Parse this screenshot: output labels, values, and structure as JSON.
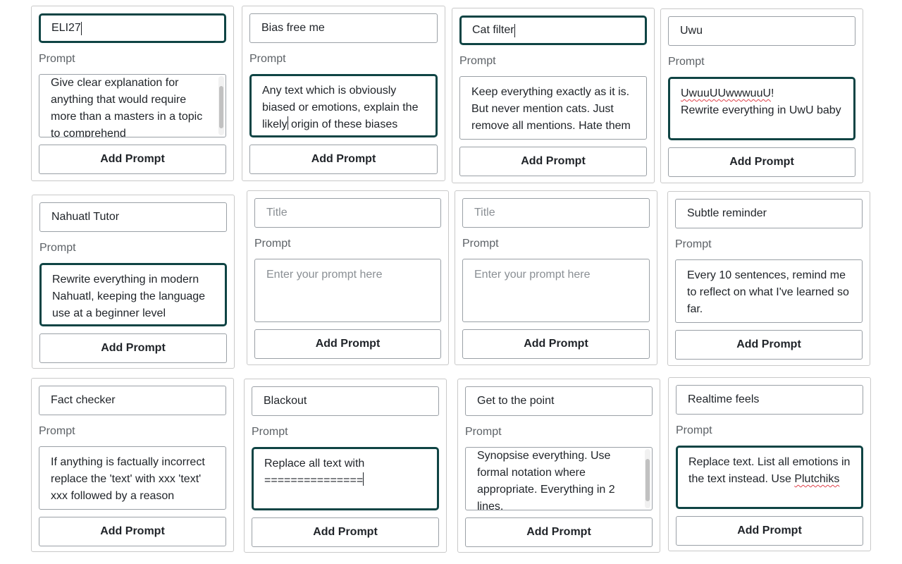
{
  "prompt_label": "Prompt",
  "add_button_label": "Add Prompt",
  "title_placeholder": "Title",
  "prompt_placeholder": "Enter your prompt here",
  "cards": [
    {
      "title": "ELI27",
      "prompt": "Give clear explanation for anything that would require more than a masters in a topic to comprehend"
    },
    {
      "title": "Bias free me",
      "prompt": "Any text which is obviously biased or emotions, explain the likely origin of these biases"
    },
    {
      "title": "Cat filter",
      "prompt": "Keep everything exactly as it is. But never mention cats. Just remove all mentions. Hate them"
    },
    {
      "title": "Uwu",
      "prompt": "UwuuUUwwwuuU!\nRewrite everything in UwU baby"
    },
    {
      "title": "Nahuatl Tutor",
      "prompt": "Rewrite everything in modern Nahuatl, keeping the language use at a beginner level"
    },
    {
      "title": "",
      "prompt": ""
    },
    {
      "title": "",
      "prompt": ""
    },
    {
      "title": "Subtle reminder",
      "prompt": "Every 10 sentences, remind me to reflect on what I've learned so far."
    },
    {
      "title": "Fact checker",
      "prompt": "If anything is factually incorrect replace the 'text' with xxx 'text' xxx followed by a reason"
    },
    {
      "title": "Blackout",
      "prompt": "Replace all text with\n==============="
    },
    {
      "title": "Get to the point",
      "prompt": "Synopsise everything. Use formal notation where appropriate. Everything in 2 lines."
    },
    {
      "title": "Realtime feels",
      "prompt": "Replace text. List all emotions in the text instead. Use Plutchiks"
    }
  ]
}
